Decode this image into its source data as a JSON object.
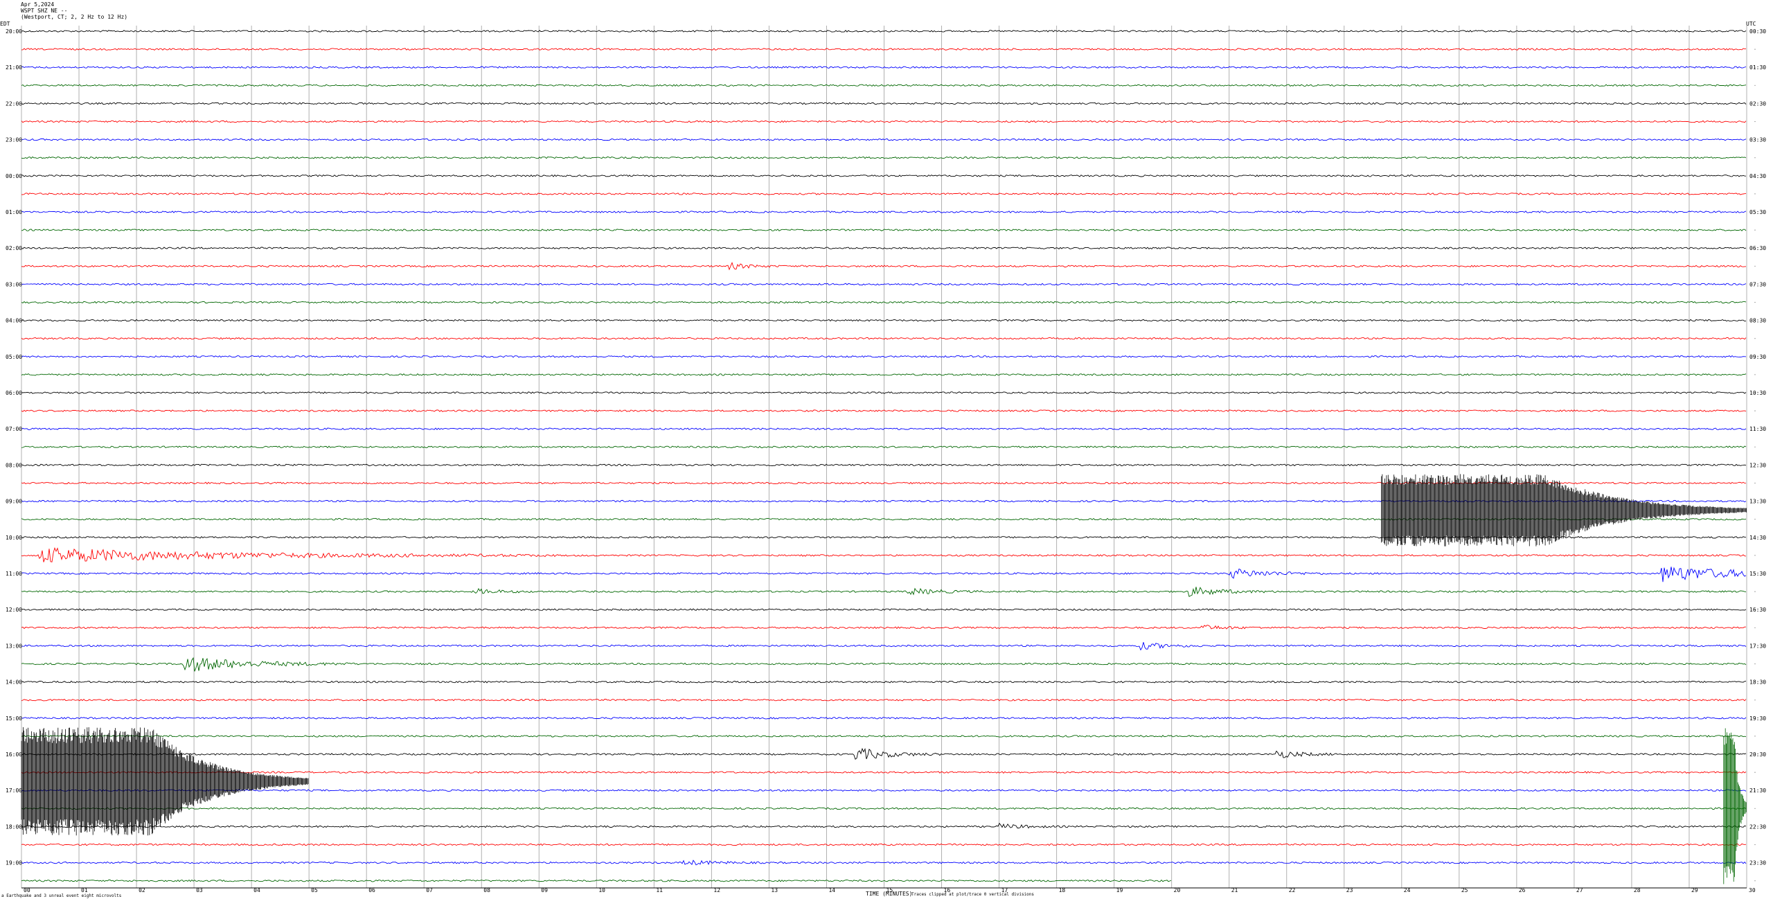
{
  "header": {
    "date": "Apr 5,2024",
    "station": "WSPT SHZ NE --",
    "location": "(Westport, CT; 2, 2 Hz to 12 Hz)"
  },
  "tz_left": "EDT",
  "tz_right": "UTC",
  "footer": {
    "xlabel": "TIME (MINUTES)",
    "note": "Traces clipped at plot/trace 0 vertical divisions",
    "left": "a  Earthquake and 3 unreal event  eight microvolts"
  },
  "chart_data": {
    "type": "helicorder",
    "title": "",
    "xlabel": "TIME (MINUTES)",
    "xlim": [
      0,
      30
    ],
    "x_ticks": [
      "00",
      "01",
      "02",
      "03",
      "04",
      "05",
      "06",
      "07",
      "08",
      "09",
      "10",
      "11",
      "12",
      "13",
      "14",
      "15",
      "16",
      "17",
      "18",
      "19",
      "20",
      "21",
      "22",
      "23",
      "24",
      "25",
      "26",
      "27",
      "28",
      "29",
      "30"
    ],
    "trace_colors": [
      "#000000",
      "#ff0000",
      "#0000ff",
      "#006600"
    ],
    "left_labels": [
      "20:00",
      "21:00",
      "22:00",
      "23:00",
      "00:00",
      "01:00",
      "02:00",
      "03:00",
      "04:00",
      "05:00",
      "06:00",
      "07:00",
      "08:00",
      "09:00",
      "10:00",
      "11:00",
      "12:00",
      "13:00",
      "14:00",
      "15:00",
      "16:00",
      "17:00",
      "18:00",
      "19:00"
    ],
    "right_labels": [
      "00:30",
      "01:30",
      "02:30",
      "03:30",
      "04:30",
      "05:30",
      "06:30",
      "07:30",
      "08:30",
      "09:30",
      "10:30",
      "11:30",
      "12:30",
      "13:30",
      "14:30",
      "15:30",
      "16:30",
      "17:30",
      "18:30",
      "19:30",
      "20:30",
      "21:30",
      "22:30",
      "23:30"
    ],
    "trace_count": 48,
    "last_trace_end_minute": 20,
    "events": [
      {
        "trace": 13,
        "minute": 12.3,
        "amp": 0.4,
        "dur": 0.3
      },
      {
        "trace": 29,
        "minute": 0.3,
        "amp": 0.9,
        "dur": 3.0
      },
      {
        "trace": 30,
        "minute": 21.0,
        "amp": 0.6,
        "dur": 0.6
      },
      {
        "trace": 30,
        "minute": 28.5,
        "amp": 1.0,
        "dur": 1.2
      },
      {
        "trace": 31,
        "minute": 7.9,
        "amp": 0.3,
        "dur": 0.4
      },
      {
        "trace": 31,
        "minute": 15.4,
        "amp": 0.4,
        "dur": 0.5
      },
      {
        "trace": 31,
        "minute": 20.3,
        "amp": 0.6,
        "dur": 0.5
      },
      {
        "trace": 33,
        "minute": 20.5,
        "amp": 0.3,
        "dur": 0.4
      },
      {
        "trace": 34,
        "minute": 19.4,
        "amp": 0.5,
        "dur": 0.4
      },
      {
        "trace": 35,
        "minute": 2.8,
        "amp": 1.0,
        "dur": 1.0
      },
      {
        "trace": 40,
        "minute": 14.5,
        "amp": 0.8,
        "dur": 0.5
      },
      {
        "trace": 40,
        "minute": 21.8,
        "amp": 0.5,
        "dur": 0.4
      },
      {
        "trace": 44,
        "minute": 17.0,
        "amp": 0.3,
        "dur": 0.4
      },
      {
        "trace": 46,
        "minute": 11.5,
        "amp": 0.3,
        "dur": 0.5
      }
    ],
    "large_events": [
      {
        "trace_start": 25,
        "trace_end": 28,
        "minute": 23.65,
        "color": "#000000",
        "decay_minutes": 6.5
      },
      {
        "trace_start": 39,
        "trace_end": 44,
        "minute": 0.0,
        "color": "#000000",
        "decay_minutes": 5.0
      },
      {
        "trace_start": 39,
        "trace_end": 47,
        "minute": 29.6,
        "color": "#006600",
        "decay_minutes": 0.4
      }
    ]
  }
}
